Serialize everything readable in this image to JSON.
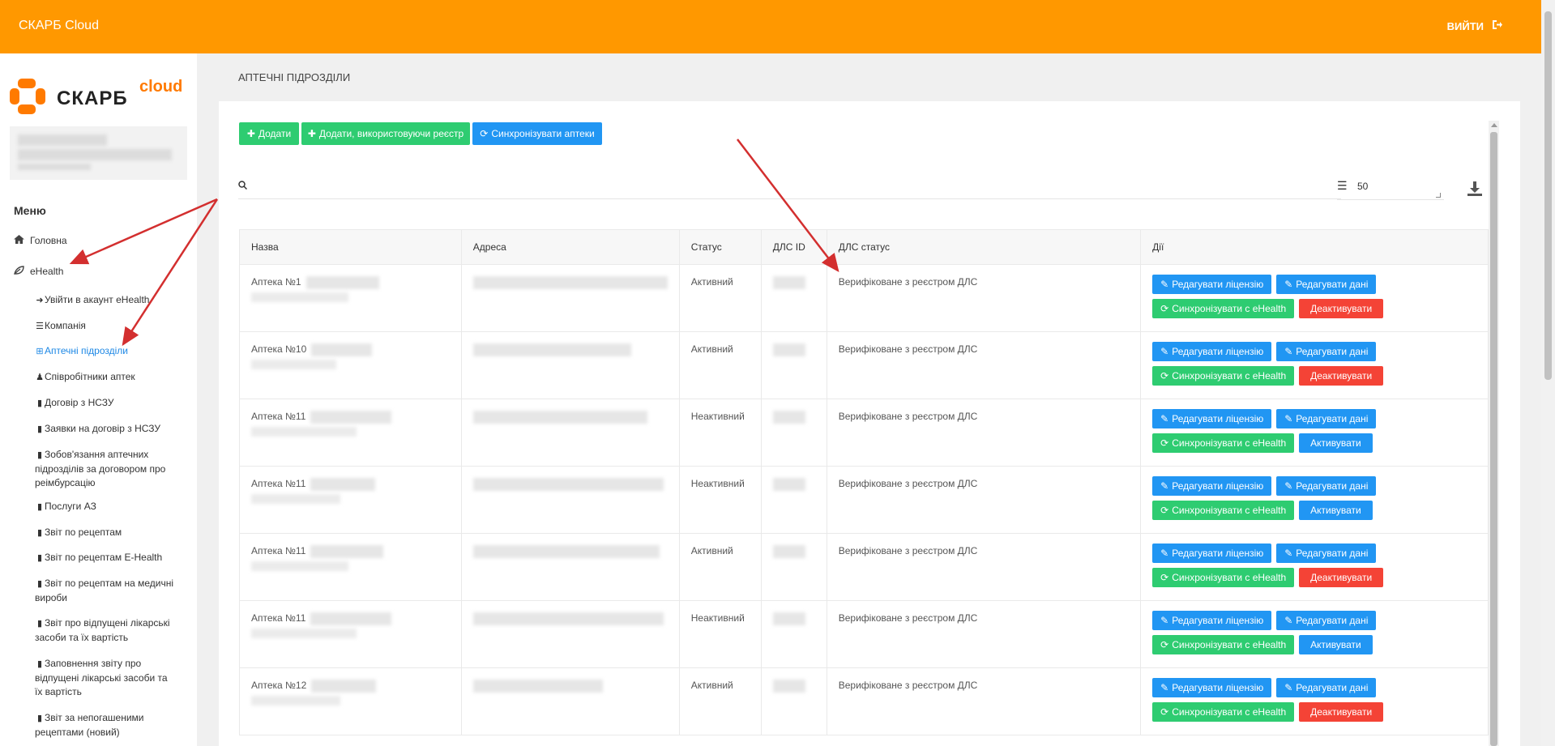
{
  "header": {
    "brand": "СКАРБ Cloud",
    "logout_label": "ВИЙТИ"
  },
  "logo": {
    "word": "СКАРБ",
    "cloud": "cloud"
  },
  "menu": {
    "title": "Меню",
    "items": [
      {
        "label": "Головна",
        "icon": "home-icon"
      },
      {
        "label": "eHealth",
        "icon": "leaf-icon"
      }
    ],
    "sub_items": [
      {
        "label": "Увійти в акаунт eHealth",
        "icon": "sign-in-icon"
      },
      {
        "label": "Компанія",
        "icon": "list-icon"
      },
      {
        "label": "Аптечні підрозділи",
        "icon": "plus-square-icon"
      },
      {
        "label": "Співробітники аптек",
        "icon": "user-icon"
      },
      {
        "label": "Договір з НСЗУ",
        "icon": "file-icon"
      },
      {
        "label": "Заявки на договір з НСЗУ",
        "icon": "file-icon"
      },
      {
        "label": "Зобов'язання аптечних підрозділів за договором про реімбурсацію",
        "icon": "file-icon"
      },
      {
        "label": "Послуги АЗ",
        "icon": "file-icon"
      },
      {
        "label": "Звіт по рецептам",
        "icon": "file-icon"
      },
      {
        "label": "Звіт по рецептам E-Health",
        "icon": "file-icon"
      },
      {
        "label": "Звіт по рецептам на медичні вироби",
        "icon": "file-icon"
      },
      {
        "label": "Звіт про відпущені лікарські засоби та їх вартість",
        "icon": "file-icon"
      },
      {
        "label": "Заповнення звіту про відпущені лікарські засоби та їх вартість",
        "icon": "file-icon"
      },
      {
        "label": "Звіт за непогашеними рецептами (новий)",
        "icon": "file-icon"
      }
    ]
  },
  "page": {
    "title": "АПТЕЧНІ ПІДРОЗДІЛИ"
  },
  "toolbar": {
    "add_label": "Додати",
    "add_registry_label": "Додати, використовуючи реєстр",
    "sync_label": "Синхронізувати аптеки"
  },
  "search": {
    "placeholder": ""
  },
  "pager": {
    "page_size": "50"
  },
  "table": {
    "headers": [
      "Назва",
      "Адреса",
      "Статус",
      "ДЛС ID",
      "ДЛС статус",
      "Дії"
    ],
    "rows": [
      {
        "name": "Аптека №1",
        "status": "Активний",
        "dls_status": "Верифіковане з реєстром ДЛС",
        "toggle_label": "Деактивувати",
        "toggle": "deactivate"
      },
      {
        "name": "Аптека №10",
        "status": "Активний",
        "dls_status": "Верифіковане з реєстром ДЛС",
        "toggle_label": "Деактивувати",
        "toggle": "deactivate"
      },
      {
        "name": "Аптека №11",
        "status": "Неактивний",
        "dls_status": "Верифіковане з реєстром ДЛС",
        "toggle_label": "Активувати",
        "toggle": "activate"
      },
      {
        "name": "Аптека №11",
        "status": "Неактивний",
        "dls_status": "Верифіковане з реєстром ДЛС",
        "toggle_label": "Активувати",
        "toggle": "activate"
      },
      {
        "name": "Аптека №11",
        "status": "Активний",
        "dls_status": "Верифіковане з реєстром ДЛС",
        "toggle_label": "Деактивувати",
        "toggle": "deactivate"
      },
      {
        "name": "Аптека №11",
        "status": "Неактивний",
        "dls_status": "Верифіковане з реєстром ДЛС",
        "toggle_label": "Активувати",
        "toggle": "activate"
      },
      {
        "name": "Аптека №12",
        "status": "Активний",
        "dls_status": "Верифіковане з реєстром ДЛС",
        "toggle_label": "Деактивувати",
        "toggle": "deactivate"
      }
    ],
    "actions": {
      "edit_license": "Редагувати ліцензію",
      "edit_data": "Редагувати дані",
      "sync_ehealth": "Синхронізувати с eHealth"
    }
  },
  "colors": {
    "header": "#ff9800",
    "green": "#2ecc71",
    "blue": "#2196f3",
    "red": "#f44336",
    "annotation_arrow": "#d32f2f"
  }
}
